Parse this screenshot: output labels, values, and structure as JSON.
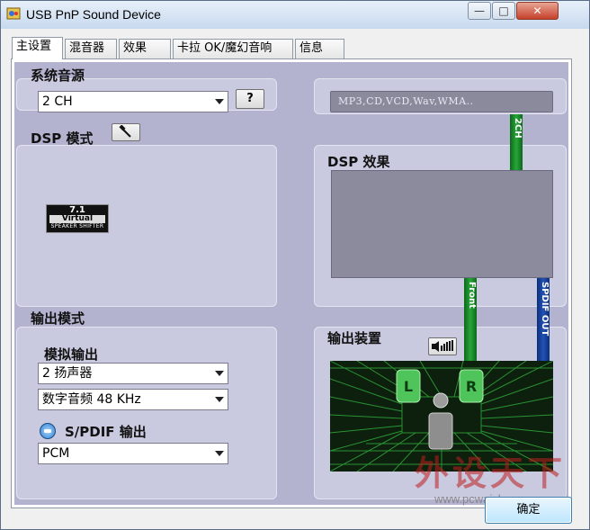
{
  "window": {
    "title": "USB PnP Sound Device",
    "minimize_glyph": "—",
    "maximize_glyph": "□",
    "close_glyph": "✕"
  },
  "tabs": [
    {
      "label": "主设置"
    },
    {
      "label": "混音器"
    },
    {
      "label": "效果"
    },
    {
      "label": "卡拉 OK/魔幻音响"
    },
    {
      "label": "信息"
    }
  ],
  "source": {
    "label": "系统音源",
    "value": "2 CH",
    "help_label": "?",
    "formats": "MP3,CD,VCD,Wav,WMA.."
  },
  "dsp_mode": {
    "label": "DSP 模式",
    "logo": {
      "line1": "7.1",
      "line2": "Virtual",
      "line3": "SPEAKER SHIFTER"
    }
  },
  "dsp_effect": {
    "label": "DSP 效果"
  },
  "output_mode": {
    "label": "输出模式",
    "analog_label": "模拟输出",
    "speakers_value": "2 扬声器",
    "digital_value": "数字音频 48 KHz",
    "spdif_label": "S/PDIF 输出",
    "spdif_value": "PCM"
  },
  "output_device": {
    "label": "输出装置"
  },
  "signal_bars": {
    "ch2": "2CH",
    "front": "Front",
    "spdif": "SPDIF OUT"
  },
  "speakers": {
    "left": "L",
    "right": "R"
  },
  "ok_button": "确定",
  "watermark": {
    "text": "外设天下",
    "url": "www.pcwaishe.cn"
  },
  "colors": {
    "panel": "#c9c9e0",
    "accent_green": "#29a43a",
    "accent_blue": "#2452b6"
  }
}
